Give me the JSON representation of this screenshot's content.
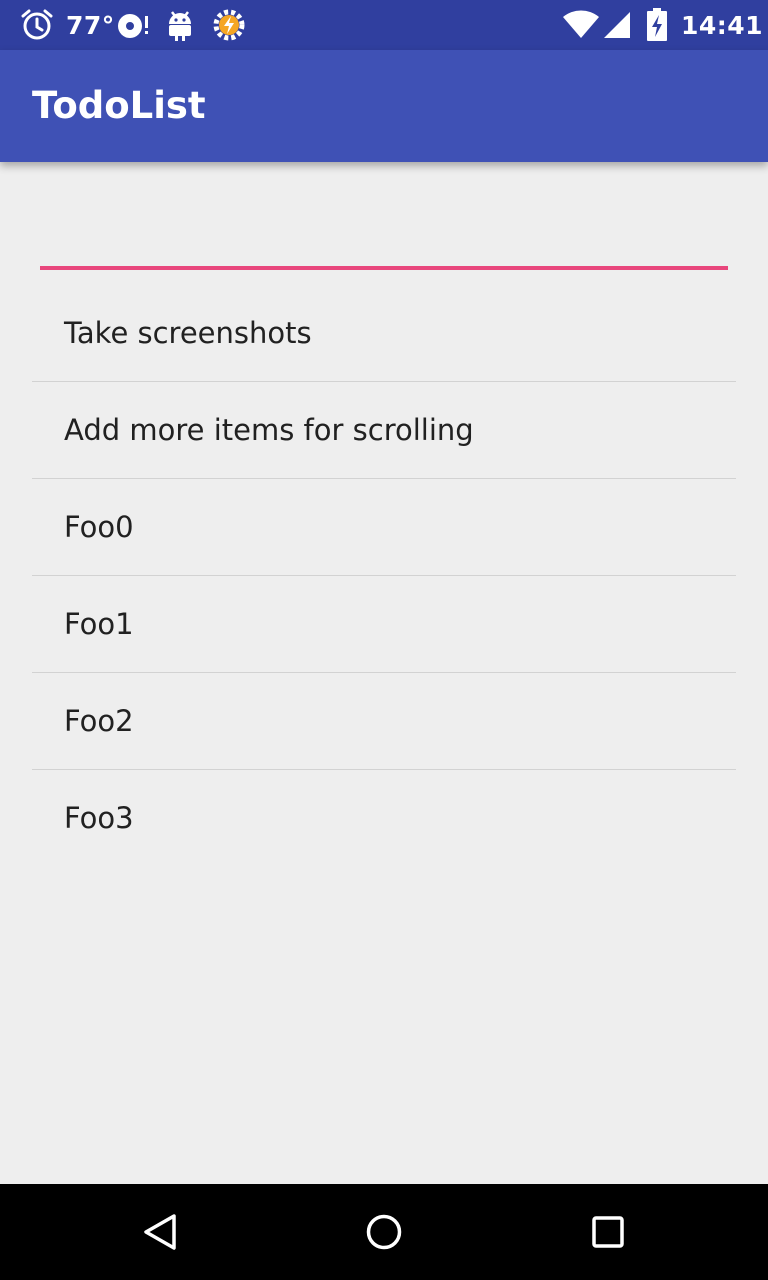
{
  "status_bar": {
    "temperature": "77°",
    "time": "14:41",
    "icons": [
      "alarm-icon",
      "disc-icon",
      "android-icon",
      "tasker-icon",
      "wifi-icon",
      "signal-icon",
      "battery-icon"
    ]
  },
  "app_bar": {
    "title": "TodoList",
    "color": "#3f51b5"
  },
  "new_item_input": {
    "value": "",
    "placeholder": "",
    "underline_color": "#e8467c"
  },
  "todo_items": [
    {
      "label": "Take screenshots"
    },
    {
      "label": "Add more items for scrolling"
    },
    {
      "label": "Foo0"
    },
    {
      "label": "Foo1"
    },
    {
      "label": "Foo2"
    },
    {
      "label": "Foo3"
    }
  ],
  "nav_bar": {
    "icons": [
      "back-icon",
      "home-icon",
      "recents-icon"
    ]
  }
}
